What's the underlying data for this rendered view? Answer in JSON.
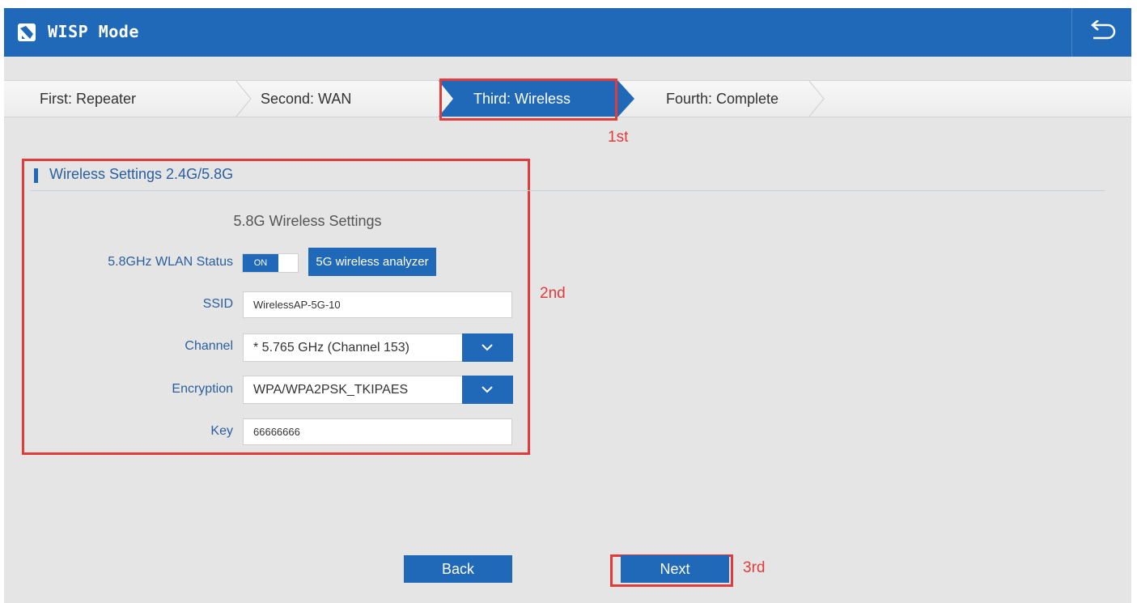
{
  "header": {
    "title": "WISP Mode",
    "app_icon": "wisp-logo-icon",
    "back_icon": "return-arrow-icon"
  },
  "steps": [
    {
      "label": "First: Repeater"
    },
    {
      "label": "Second: WAN"
    },
    {
      "label": "Third: Wireless",
      "active": true
    },
    {
      "label": "Fourth: Complete"
    }
  ],
  "annotations": {
    "first": "1st",
    "second": "2nd",
    "third": "3rd"
  },
  "section": {
    "title": "Wireless Settings 2.4G/5.8G",
    "subheading": "5.8G Wireless Settings"
  },
  "form": {
    "wlan_status_label": "5.8GHz WLAN Status",
    "wlan_toggle": "ON",
    "analyzer_button": "5G wireless analyzer",
    "ssid_label": "SSID",
    "ssid_value": "WirelessAP-5G-10",
    "channel_label": "Channel",
    "channel_value": "* 5.765 GHz (Channel 153)",
    "encryption_label": "Encryption",
    "encryption_value": "WPA/WPA2PSK_TKIPAES",
    "key_label": "Key",
    "key_value": "66666666"
  },
  "buttons": {
    "back": "Back",
    "next": "Next"
  },
  "colors": {
    "primary": "#2068b8",
    "annotation_red": "#e23b3b",
    "background": "#e5e5e5"
  }
}
